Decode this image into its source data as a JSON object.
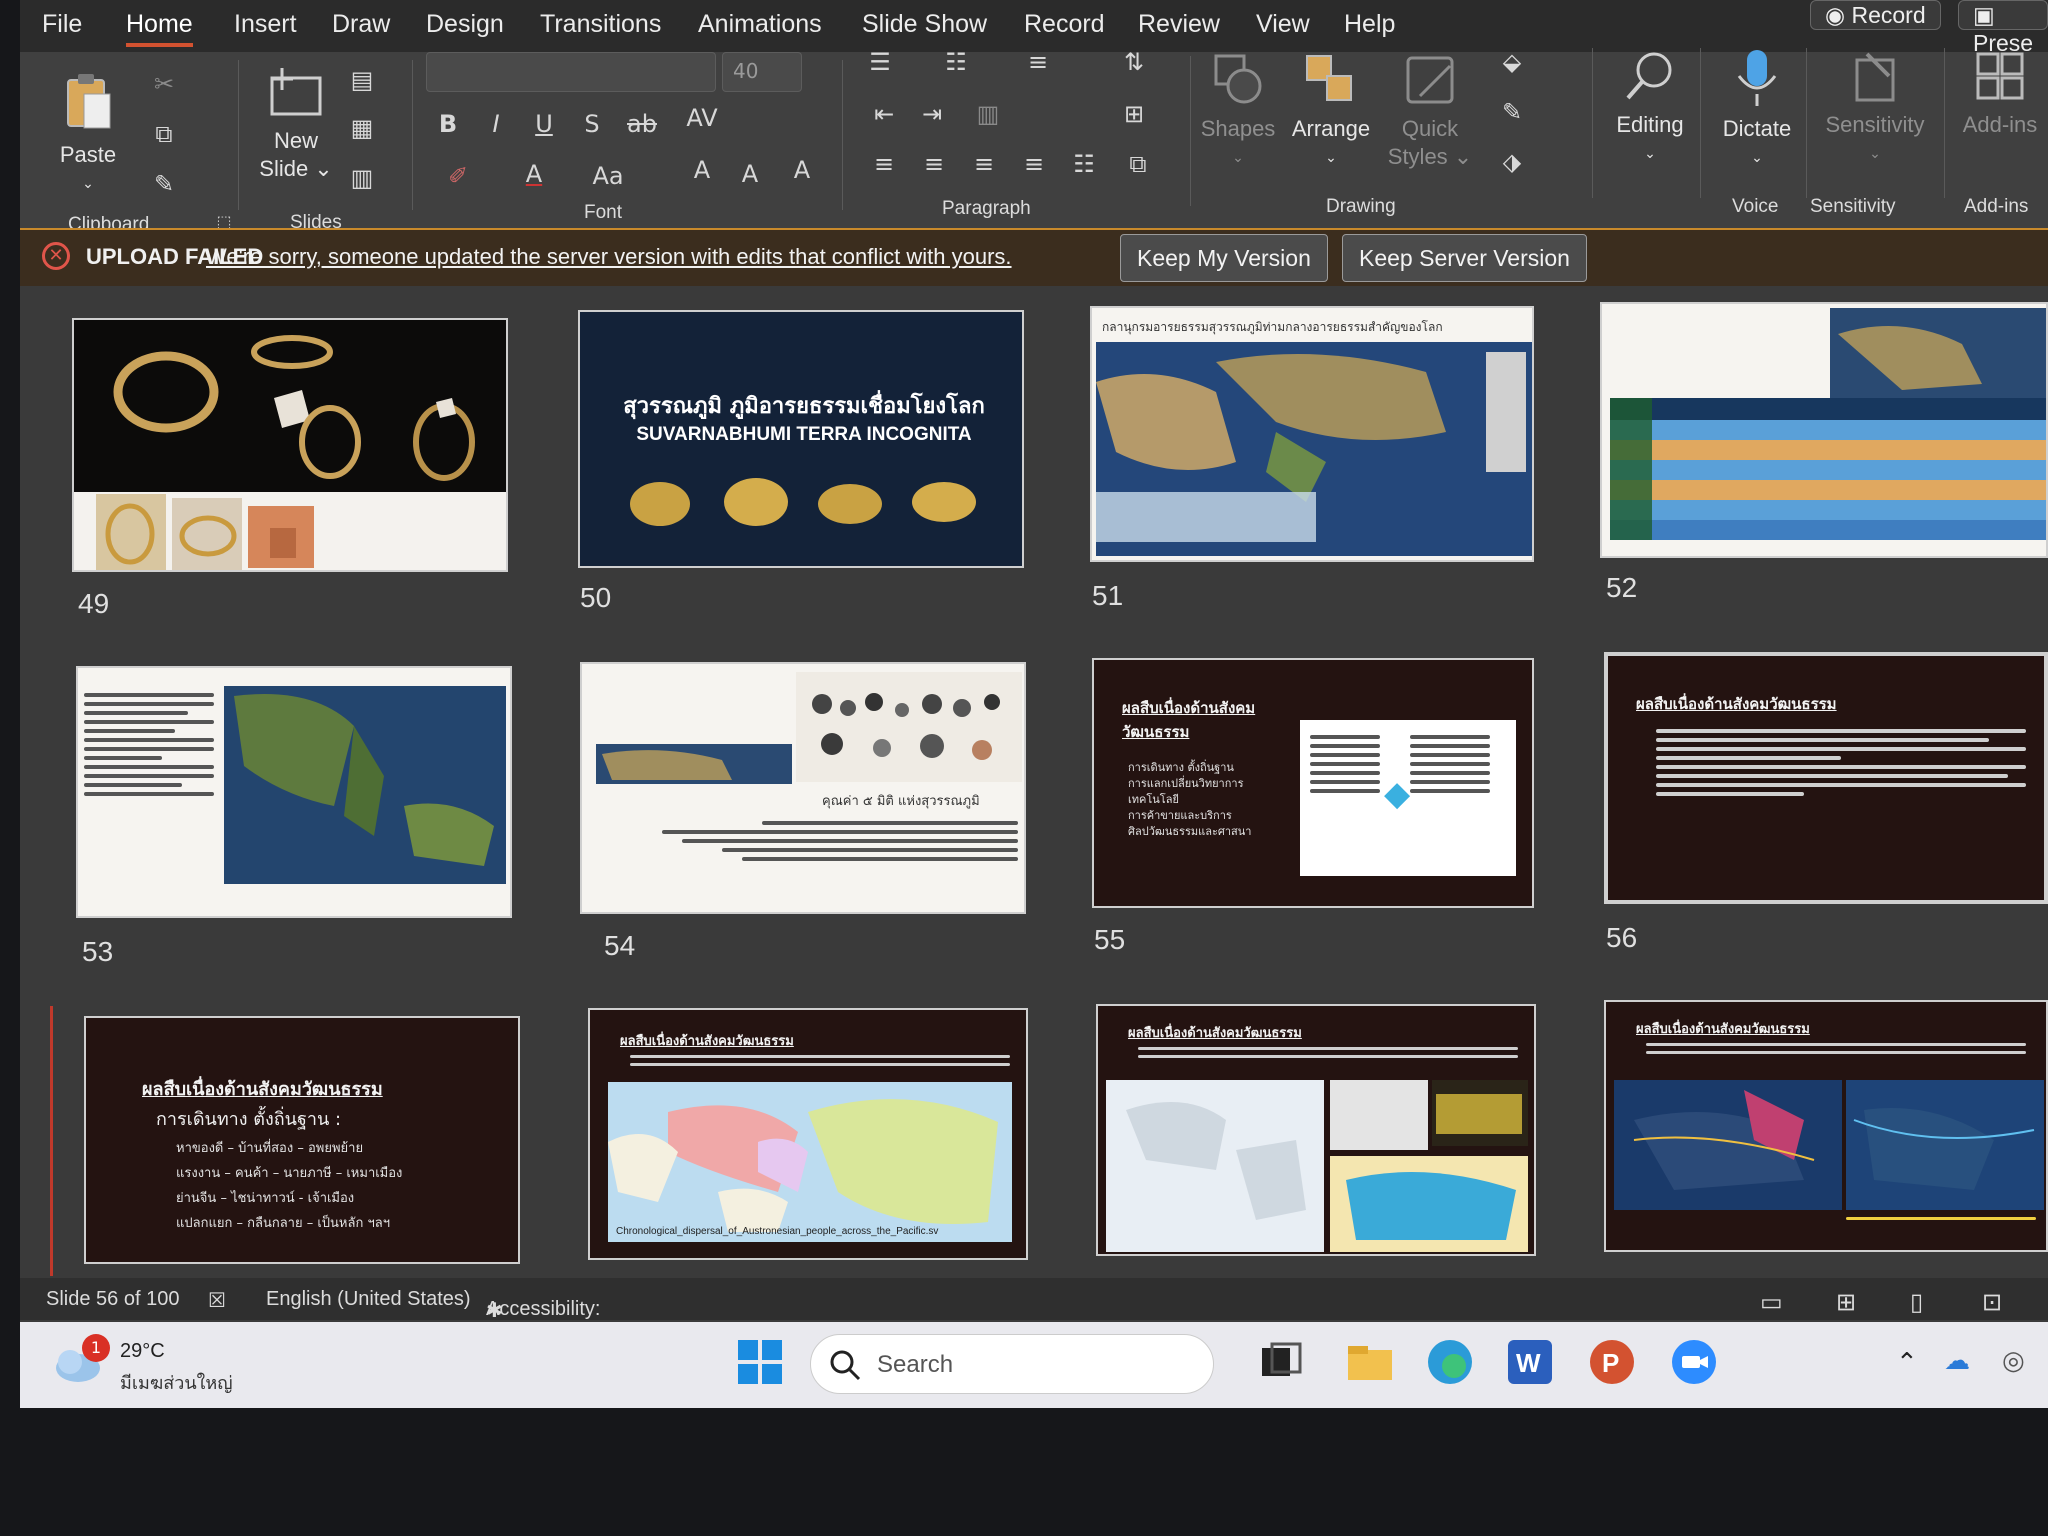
{
  "menu": {
    "tabs": [
      "File",
      "Home",
      "Insert",
      "Draw",
      "Design",
      "Transitions",
      "Animations",
      "Slide Show",
      "Record",
      "Review",
      "View",
      "Help"
    ],
    "active": "Home",
    "record_btn": "Record",
    "present_btn": "Prese"
  },
  "ribbon": {
    "paste": "Paste",
    "clipboard": "Clipboard",
    "new_slide_1": "New",
    "new_slide_2": "Slide",
    "slides": "Slides",
    "font_size": "40",
    "font": "Font",
    "paragraph": "Paragraph",
    "shapes": "Shapes",
    "arrange": "Arrange",
    "quick_styles_1": "Quick",
    "quick_styles_2": "Styles",
    "drawing": "Drawing",
    "editing": "Editing",
    "dictate": "Dictate",
    "voice": "Voice",
    "sensitivity": "Sensitivity",
    "sensitivity_group": "Sensitivity",
    "addins": "Add-ins",
    "addins_group": "Add-ins"
  },
  "upload_bar": {
    "title": "UPLOAD FAILED",
    "message": "We're sorry, someone updated the server version with edits that conflict with yours.",
    "keep_mine": "Keep My Version",
    "keep_server": "Keep Server Version"
  },
  "slides": {
    "s49": "49",
    "s50": "50",
    "s51": "51",
    "s52": "52",
    "s53": "53",
    "s54": "54",
    "s55": "55",
    "s56": "56",
    "s50_title_th": "สุวรรณภูมิ ภูมิอารยธรรมเชื่อมโยงโลก",
    "s50_title_en": "SUVARNABHUMI TERRA INCOGNITA",
    "s51_title": "กลานุกรมอารยธรรมสุวรรณภูมิท่ามกลางอารยธรรมสำคัญของโลก",
    "s54_caption": "คุณค่า ๕ มิติ แห่งสุวรรณภูมิ",
    "s55_heading": "ผลสืบเนื่องด้านสังคมวัฒนธรรม",
    "s55_items": [
      "การเดินทาง ตั้งถิ่นฐาน",
      "การแลกเปลี่ยนวิทยาการ เทคโนโลยี",
      "การค้าขายและบริการ",
      "ศิลปวัฒนธรรมและศาสนา"
    ],
    "s56_heading": "ผลสืบเนื่องด้านสังคมวัฒนธรรม",
    "s57_heading": "ผลสืบเนื่องด้านสังคมวัฒนธรรม",
    "s57_sub": "การเดินทาง ตั้งถิ่นฐาน :",
    "s57_items": [
      "หาของดี – บ้านที่สอง – อพยพย้าย",
      "แรงงาน – คนค้า – นายภาษี – เหมาเมือง",
      "ย่านจีน – ไชน่าทาวน์ - เจ้าเมือง",
      "แปลกแยก – กลืนกลาย – เป็นหลัก ฯลฯ"
    ],
    "s58_heading": "ผลสืบเนื่องด้านสังคมวัฒนธรรม",
    "s58_caption": "Chronological_dispersal_of_Austronesian_people_across_the_Pacific.sv",
    "s59_heading": "ผลสืบเนื่องด้านสังคมวัฒนธรรม",
    "s60_heading": "ผลสืบเนื่องด้านสังคมวัฒนธรรม"
  },
  "status": {
    "slide": "Slide 56 of 100",
    "language": "English (United States)",
    "accessibility": "Accessibility: Unavailable"
  },
  "taskbar": {
    "temp": "29°C",
    "weather": "มีเมฆส่วนใหญ่",
    "badge": "1",
    "search": "Search"
  }
}
